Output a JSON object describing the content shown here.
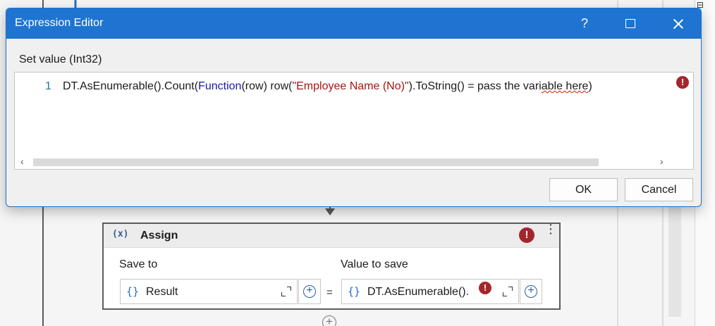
{
  "dialog": {
    "title": "Expression Editor",
    "help_glyph": "?",
    "set_value_label": "Set value (Int32)",
    "line_number": "1",
    "code": {
      "part1": "DT.AsEnumerable().Count(",
      "keyword": "Function",
      "part2": "(row) row(",
      "string": "\"Employee Name (No)\"",
      "part3": ").ToString() = pass the vari",
      "squiggled": "able here",
      "part4": ")"
    },
    "error_glyph": "!",
    "scroll_left_glyph": "‹",
    "scroll_right_glyph": "›",
    "ok_label": "OK",
    "cancel_label": "Cancel"
  },
  "assign": {
    "icon_text": "(x)",
    "title": "Assign",
    "error_glyph": "!",
    "menu_glyph": "⋮",
    "save_to_label": "Save to",
    "value_label": "Value to save",
    "brace_glyph": "{}",
    "save_to_value": "Result",
    "value_text": "DT.AsEnumerable().",
    "equals": "=",
    "plus_glyph": "+"
  },
  "background": {
    "panel_glyph_top": "⊟",
    "add_glyph": "+"
  },
  "colors": {
    "titlebar": "#1f74d1",
    "error": "#a4262c",
    "keyword": "#1a1aa6",
    "string": "#a31515",
    "squiggle": "#e51400"
  },
  "icons": [
    "help-icon",
    "maximize-icon",
    "close-icon",
    "error-icon",
    "variable-icon",
    "more-options-icon",
    "expression-brace-icon",
    "expand-editor-icon",
    "add-icon"
  ]
}
